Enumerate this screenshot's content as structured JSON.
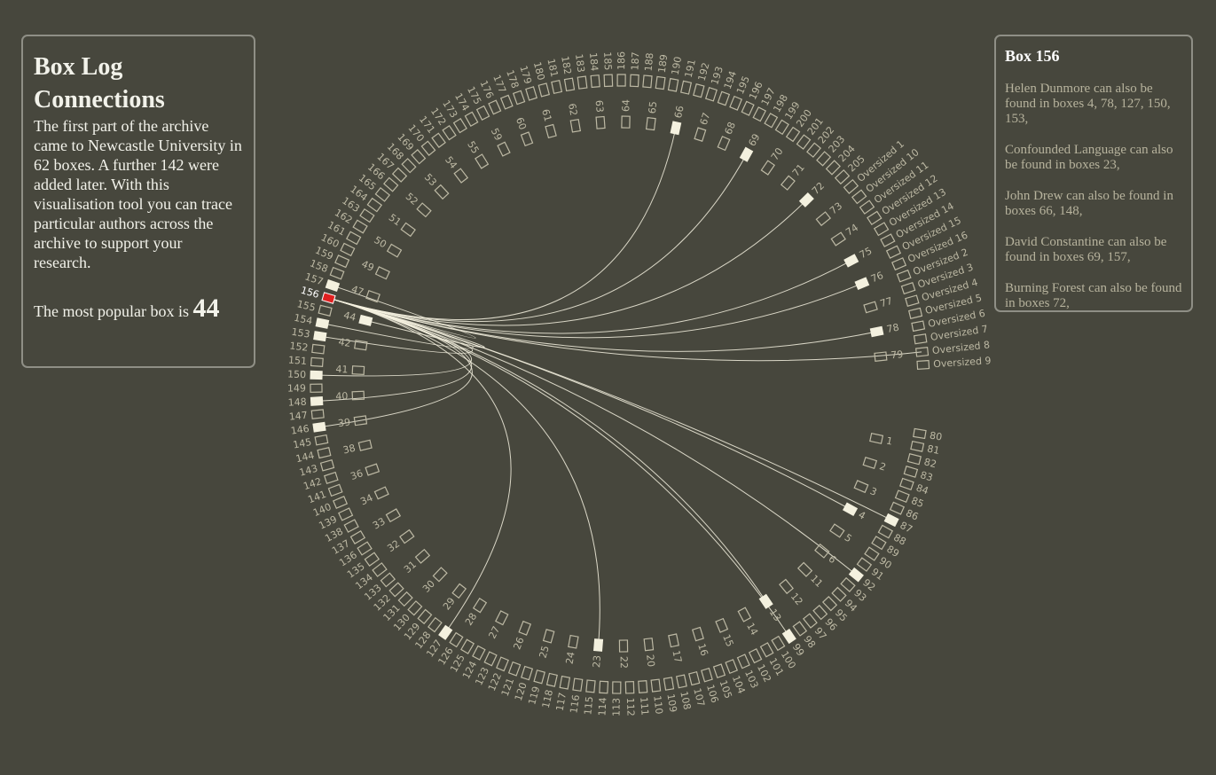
{
  "intro": {
    "title": "Box Log Connections",
    "description": "The first part of the archive came to Newcastle University in 62 boxes. A further 142 were added later. With this visualisation tool you can trace particular authors across the archive to support your research.",
    "popular_prefix": "The most popular box is",
    "popular_box": "44"
  },
  "detail": {
    "title": "Box 156",
    "connections": [
      "Helen Dunmore can also be found in boxes 4, 78, 127, 150, 153,",
      "Confounded Language can also be found in boxes 23,",
      "John Drew can also be found in boxes 66, 148,",
      "David Constantine can also be found in boxes 69, 157,",
      "Burning Forest can also be found in boxes 72,"
    ]
  },
  "chart_data": {
    "type": "chord",
    "selected_box": "156",
    "outer_ring": [
      "Oversized 9",
      "Oversized 8",
      "Oversized 7",
      "Oversized 6",
      "Oversized 5",
      "Oversized 4",
      "Oversized 3",
      "Oversized 2",
      "Oversized 16",
      "Oversized 15",
      "Oversized 14",
      "Oversized 13",
      "Oversized 12",
      "Oversized 11",
      "Oversized 10",
      "Oversized 1",
      "205",
      "204",
      "203",
      "202",
      "201",
      "200",
      "199",
      "198",
      "197",
      "196",
      "195",
      "194",
      "193",
      "192",
      "191",
      "190",
      "189",
      "188",
      "187",
      "186",
      "185",
      "184",
      "183",
      "182",
      "181",
      "180",
      "179",
      "178",
      "177",
      "176",
      "175",
      "174",
      "173",
      "172",
      "171",
      "170",
      "169",
      "168",
      "167",
      "166",
      "165",
      "164",
      "163",
      "162",
      "161",
      "160",
      "159",
      "158",
      "157",
      "156",
      "155",
      "154",
      "153",
      "152",
      "151",
      "150",
      "149",
      "148",
      "147",
      "146",
      "145",
      "144",
      "143",
      "142",
      "141",
      "140",
      "139",
      "138",
      "137",
      "136",
      "135",
      "134",
      "133",
      "132",
      "131",
      "130",
      "129",
      "128",
      "127",
      "126",
      "125",
      "124",
      "123",
      "122",
      "121",
      "120",
      "119",
      "118",
      "117",
      "116",
      "115",
      "114",
      "113",
      "112",
      "111",
      "110",
      "109",
      "108",
      "107",
      "106",
      "105",
      "104",
      "103",
      "102",
      "101",
      "100",
      "99",
      "98",
      "97",
      "96",
      "95",
      "94",
      "93",
      "92",
      "91",
      "90",
      "89",
      "88",
      "87",
      "86",
      "85",
      "84",
      "83",
      "82",
      "81",
      "80"
    ],
    "inner_ring": [
      "79",
      "78",
      "77",
      "76",
      "75",
      "74",
      "73",
      "72",
      "71",
      "70",
      "69",
      "68",
      "67",
      "66",
      "65",
      "64",
      "63",
      "62",
      "61",
      "60",
      "59",
      "55",
      "54",
      "53",
      "52",
      "51",
      "50",
      "49",
      "47",
      "44",
      "42",
      "41",
      "40",
      "39",
      "38",
      "36",
      "34",
      "33",
      "32",
      "31",
      "30",
      "29",
      "28",
      "27",
      "26",
      "25",
      "24",
      "23",
      "22",
      "20",
      "17",
      "16",
      "15",
      "14",
      "13",
      "12",
      "11",
      "6",
      "5",
      "4",
      "3",
      "2",
      "1"
    ],
    "highlighted": [
      "157",
      "156",
      "154",
      "153",
      "150",
      "148",
      "146",
      "127",
      "23",
      "13",
      "99",
      "92",
      "87",
      "4",
      "78",
      "75",
      "76",
      "72",
      "69",
      "66",
      "44"
    ],
    "links": [
      [
        "156",
        "66"
      ],
      [
        "156",
        "69"
      ],
      [
        "156",
        "72"
      ],
      [
        "156",
        "75"
      ],
      [
        "156",
        "76"
      ],
      [
        "156",
        "78"
      ],
      [
        "156",
        "Oversized 8"
      ],
      [
        "156",
        "4"
      ],
      [
        "156",
        "87"
      ],
      [
        "156",
        "92"
      ],
      [
        "156",
        "99"
      ],
      [
        "156",
        "13"
      ],
      [
        "156",
        "23"
      ],
      [
        "156",
        "127"
      ],
      [
        "156",
        "157"
      ],
      [
        "156",
        "154"
      ],
      [
        "156",
        "153"
      ],
      [
        "156",
        "150"
      ],
      [
        "156",
        "148"
      ],
      [
        "156",
        "146"
      ],
      [
        "156",
        "44"
      ]
    ]
  }
}
